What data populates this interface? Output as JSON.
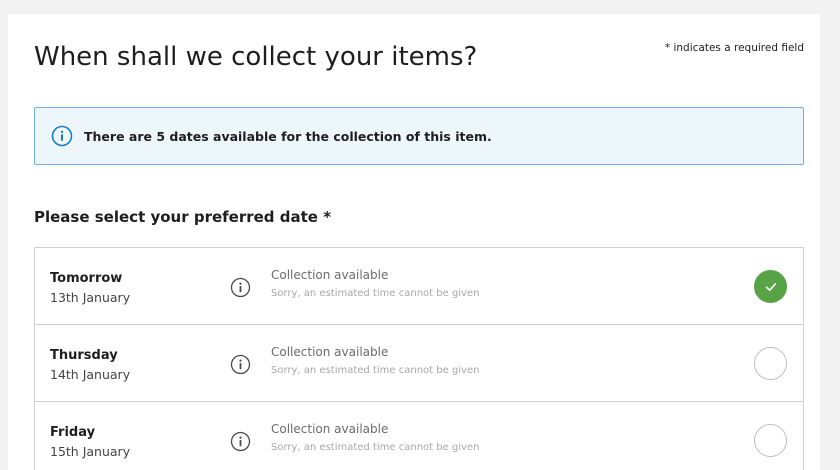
{
  "heading": "When shall we collect your items?",
  "required_note": "* indicates a required field",
  "info_banner": {
    "icon": "info-icon",
    "text": "There are 5 dates available for the collection of this item."
  },
  "section_label": "Please select your preferred date *",
  "dates": [
    {
      "day": "Tomorrow",
      "date": "13th January",
      "status": "Collection available",
      "sub": "Sorry, an estimated time cannot be given",
      "selected": true
    },
    {
      "day": "Thursday",
      "date": "14th January",
      "status": "Collection available",
      "sub": "Sorry, an estimated time cannot be given",
      "selected": false
    },
    {
      "day": "Friday",
      "date": "15th January",
      "status": "Collection available",
      "sub": "Sorry, an estimated time cannot be given",
      "selected": false
    }
  ],
  "colors": {
    "selected_green": "#57a345",
    "banner_border": "#6ab2d6",
    "banner_bg": "#ecf6fb"
  }
}
